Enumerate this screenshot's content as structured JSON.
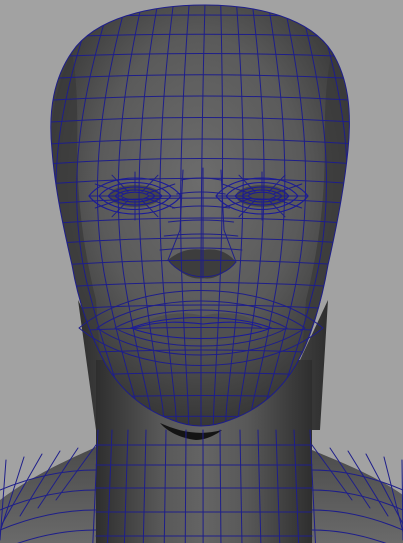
{
  "viewport": {
    "background_color": "#a2a2a2",
    "mesh_color": "#5a5a5a",
    "wireframe_color": "#1e1e8a",
    "shading": "smooth-shaded-with-wireframe",
    "object": "head-mesh"
  }
}
